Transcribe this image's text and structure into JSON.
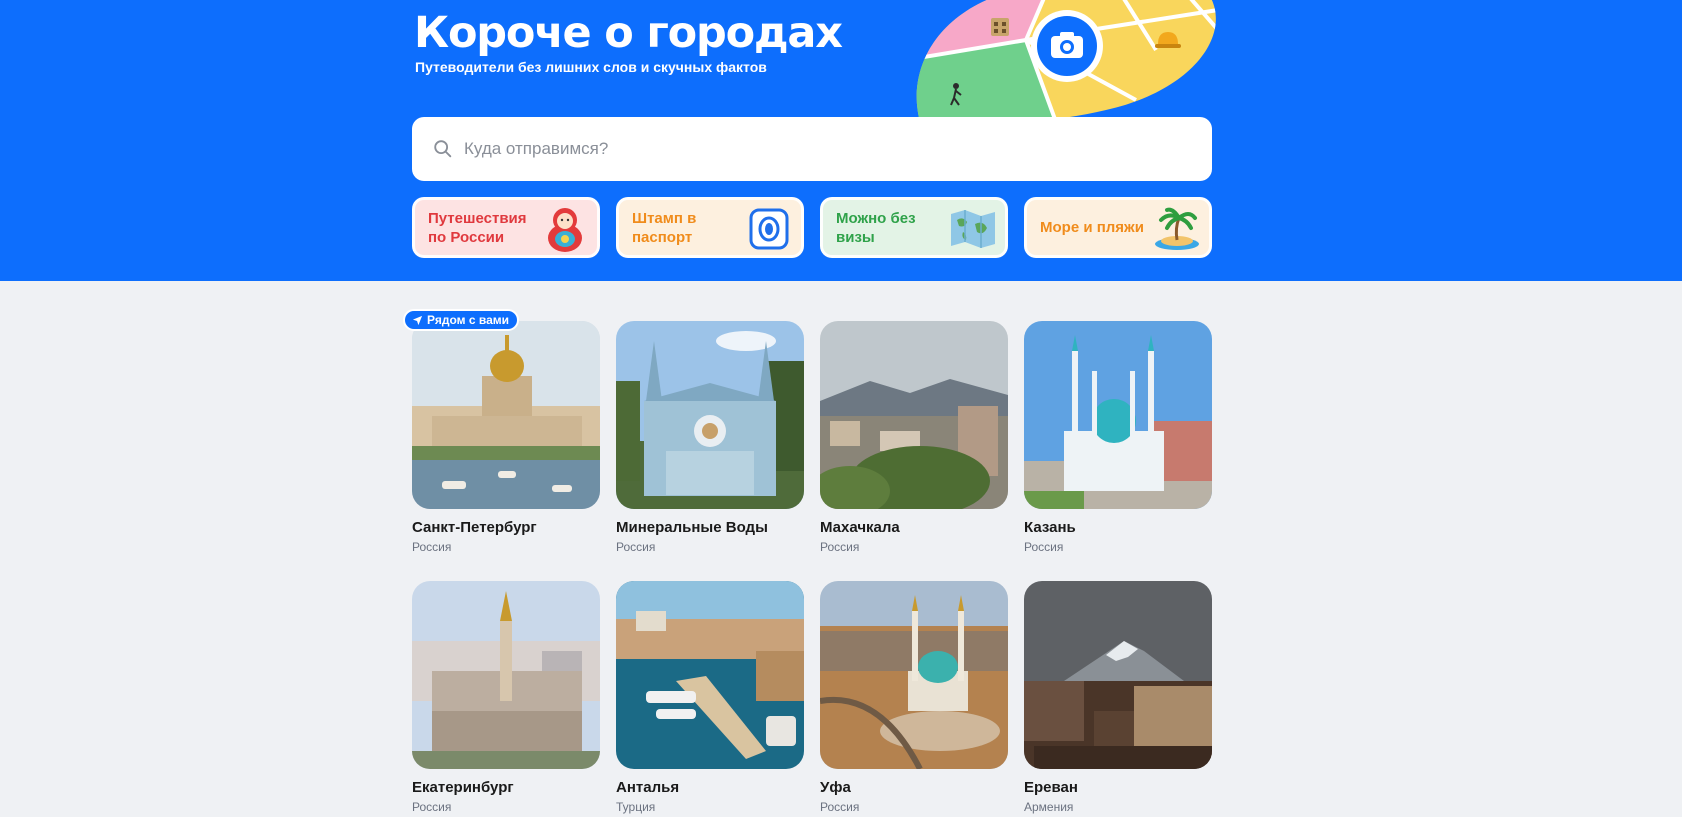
{
  "hero": {
    "title": "Короче о городах",
    "subtitle": "Путеводители без лишних слов и скучных фактов",
    "accent_color": "#0d6efd",
    "illustration_icons": [
      "map-icon",
      "camera-icon",
      "hotel-icon",
      "bell-icon",
      "walker-icon"
    ]
  },
  "search": {
    "placeholder": "Куда отправимся?",
    "icon": "search-icon"
  },
  "categories": [
    {
      "label": "Путешествия по России",
      "icon": "matryoshka-icon",
      "bg": "#fde3e3",
      "color": "#e0393e"
    },
    {
      "label": "Штамп в паспорт",
      "icon": "passport-stamp-icon",
      "bg": "#fdf0df",
      "color": "#f08c1c"
    },
    {
      "label": "Можно без визы",
      "icon": "world-map-icon",
      "bg": "#e3f3e6",
      "color": "#2fa24a"
    },
    {
      "label": "Море и пляжи",
      "icon": "palm-island-icon",
      "bg": "#fdf0df",
      "color": "#f08c1c"
    }
  ],
  "badge": {
    "label": "Рядом с вами",
    "icon": "location-arrow-icon"
  },
  "cities": [
    {
      "name": "Санкт-Петербург",
      "country": "Россия"
    },
    {
      "name": "Минеральные Воды",
      "country": "Россия"
    },
    {
      "name": "Махачкала",
      "country": "Россия"
    },
    {
      "name": "Казань",
      "country": "Россия"
    },
    {
      "name": "Екатеринбург",
      "country": "Россия"
    },
    {
      "name": "Анталья",
      "country": "Турция"
    },
    {
      "name": "Уфа",
      "country": "Россия"
    },
    {
      "name": "Ереван",
      "country": "Армения"
    }
  ]
}
